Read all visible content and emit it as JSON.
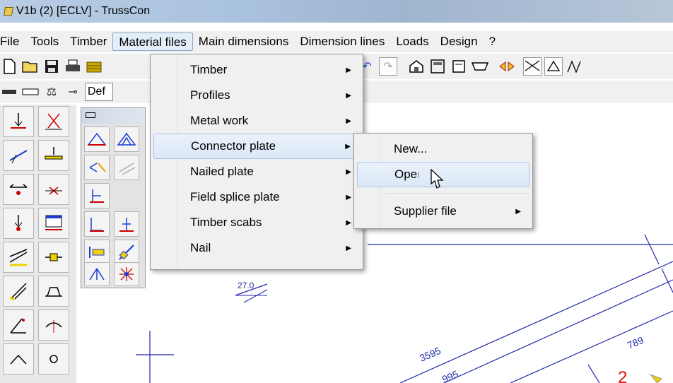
{
  "window": {
    "title": "V1b (2) [ECLV] - TrussCon"
  },
  "menubar": {
    "items": [
      "File",
      "Tools",
      "Timber",
      "Material files",
      "Main dimensions",
      "Dimension lines",
      "Loads",
      "Design",
      "?"
    ]
  },
  "toolbar": {
    "combo_value": "Def"
  },
  "material_menu": {
    "items": [
      {
        "label": "Timber"
      },
      {
        "label": "Profiles"
      },
      {
        "label": "Metal work"
      },
      {
        "label": "Connector plate"
      },
      {
        "label": "Nailed plate"
      },
      {
        "label": "Field splice plate"
      },
      {
        "label": "Timber scabs"
      },
      {
        "label": "Nail"
      }
    ]
  },
  "connector_submenu": {
    "items": [
      {
        "label": "New..."
      },
      {
        "label": "Open..."
      },
      {
        "label": "Supplier file"
      }
    ]
  },
  "drawing": {
    "angle_label": "27.0",
    "dim_a": "3595",
    "dim_b": "789",
    "dim_c": "995",
    "node_number": "2"
  },
  "colors": {
    "drawing_lines": "#1f2aa8",
    "menu_highlight": "#dbe8f7",
    "node_red": "#e01010"
  }
}
